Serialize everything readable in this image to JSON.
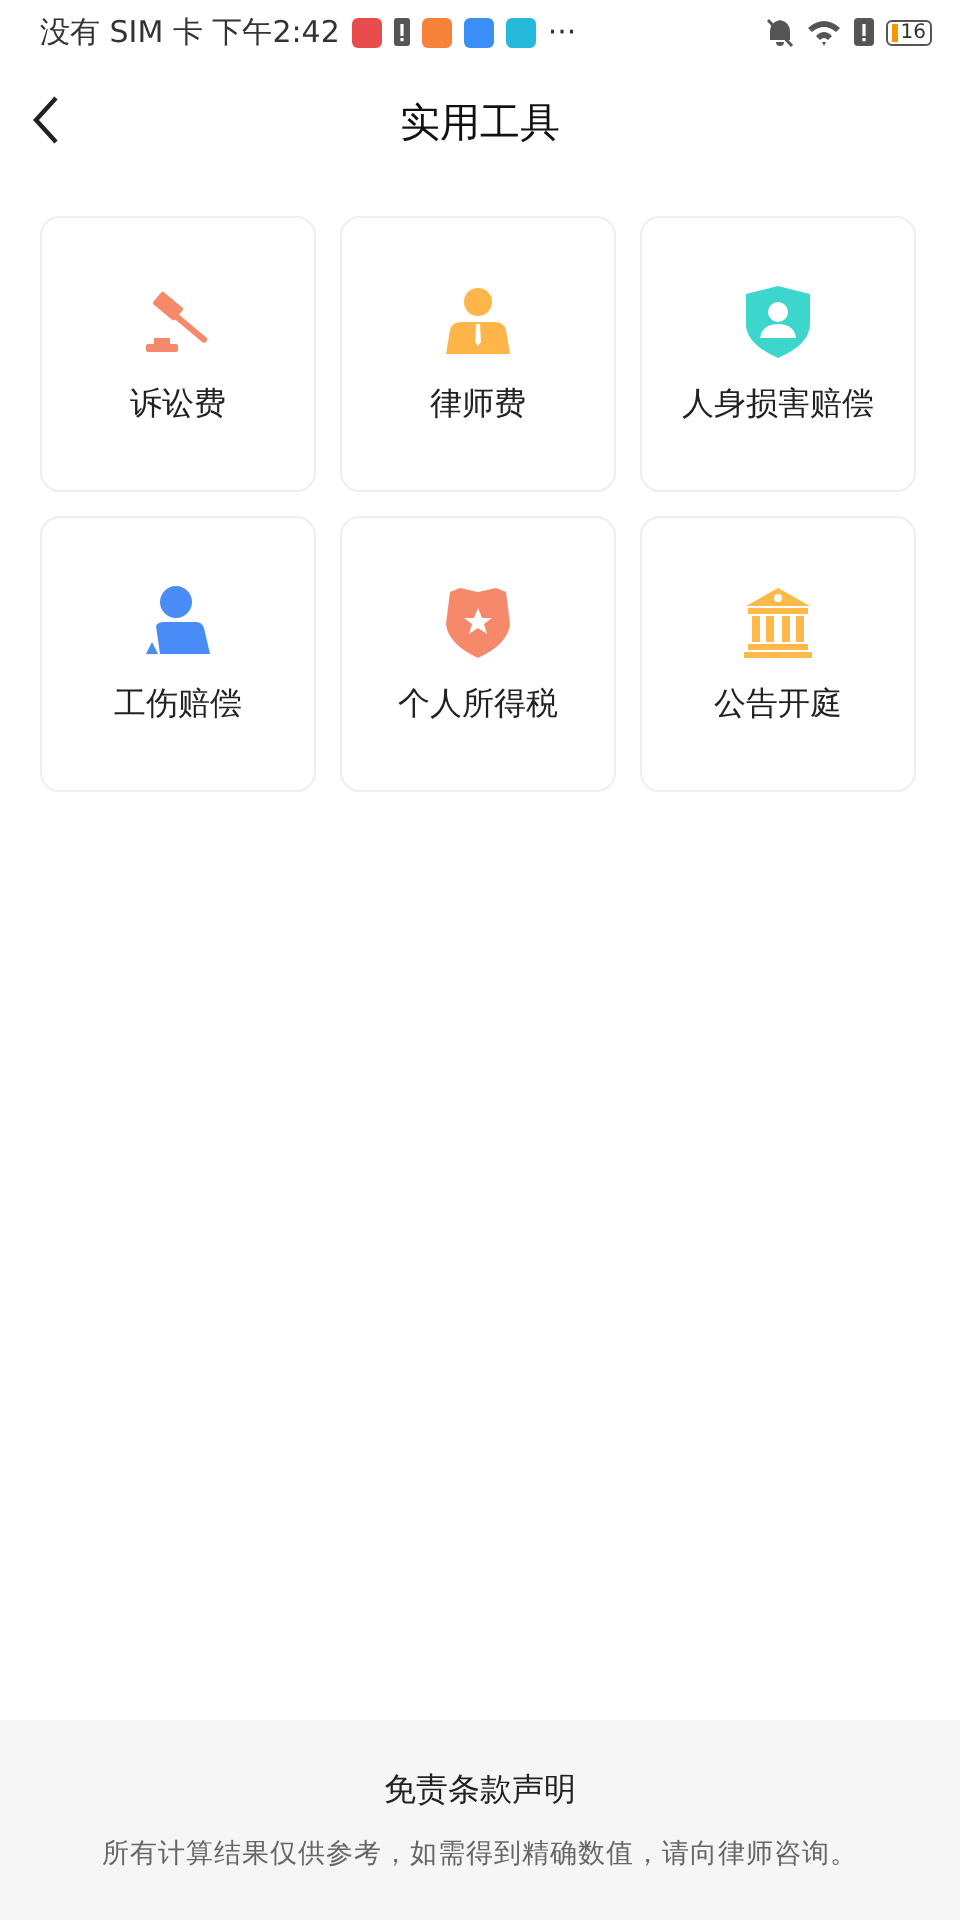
{
  "status_bar": {
    "carrier_time": "没有 SIM 卡 下午2:42",
    "more": "···",
    "battery": "16"
  },
  "header": {
    "title": "实用工具"
  },
  "tools": [
    {
      "label": "诉讼费",
      "kind": "gavel",
      "color": "#f5896a"
    },
    {
      "label": "律师费",
      "kind": "lawyer",
      "color": "#ffb54a"
    },
    {
      "label": "人身损害赔偿",
      "kind": "shield",
      "color": "#3dd6cc"
    },
    {
      "label": "工伤赔偿",
      "kind": "person",
      "color": "#4a8cf7"
    },
    {
      "label": "个人所得税",
      "kind": "badge",
      "color": "#f5896a"
    },
    {
      "label": "公告开庭",
      "kind": "court",
      "color": "#ffb84a"
    }
  ],
  "footer": {
    "title": "免责条款声明",
    "text": "所有计算结果仅供参考，如需得到精确数值，请向律师咨询。"
  }
}
